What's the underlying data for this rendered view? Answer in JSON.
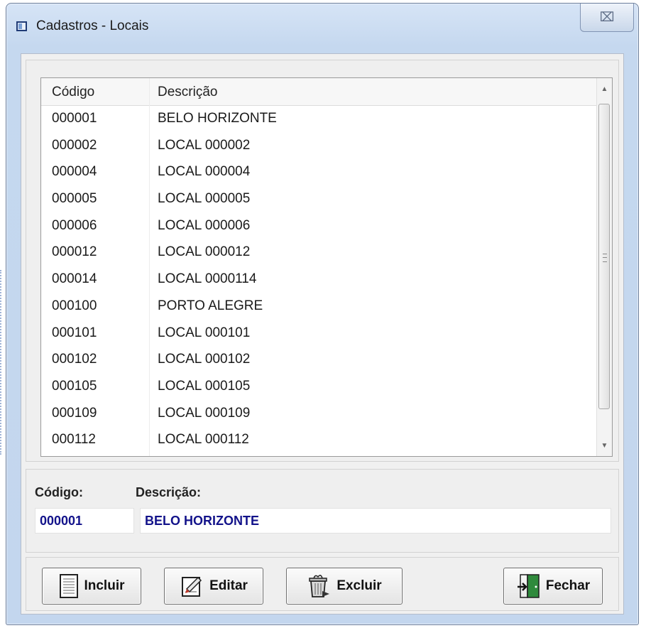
{
  "window": {
    "title": "Cadastros - Locais",
    "close_glyph": "⌧"
  },
  "grid": {
    "columns": [
      "Código",
      "Descrição"
    ],
    "rows": [
      [
        "000001",
        "BELO HORIZONTE"
      ],
      [
        "000002",
        "LOCAL 000002"
      ],
      [
        "000004",
        "LOCAL 000004"
      ],
      [
        "000005",
        "LOCAL 000005"
      ],
      [
        "000006",
        "LOCAL 000006"
      ],
      [
        "000012",
        "LOCAL 000012"
      ],
      [
        "000014",
        "LOCAL 0000114"
      ],
      [
        "000100",
        "PORTO ALEGRE"
      ],
      [
        "000101",
        "LOCAL 000101"
      ],
      [
        "000102",
        "LOCAL 000102"
      ],
      [
        "000105",
        "LOCAL 000105"
      ],
      [
        "000109",
        "LOCAL 000109"
      ],
      [
        "000112",
        "LOCAL 000112"
      ]
    ],
    "scroll_up_glyph": "▲",
    "scroll_down_glyph": "▼"
  },
  "form": {
    "codigo_label": "Código:",
    "descricao_label": "Descrição:",
    "codigo_value": "000001",
    "descricao_value": "BELO HORIZONTE"
  },
  "buttons": {
    "incluir": "Incluir",
    "editar": "Editar",
    "excluir": "Excluir",
    "fechar": "Fechar"
  },
  "icons": {
    "app": "window-icon",
    "incluir": "blank-document-icon",
    "editar": "edit-document-icon",
    "excluir": "trash-can-icon",
    "fechar": "exit-door-icon"
  },
  "colors": {
    "field_text": "#12128a",
    "title_bar": "#c5d8ef"
  }
}
